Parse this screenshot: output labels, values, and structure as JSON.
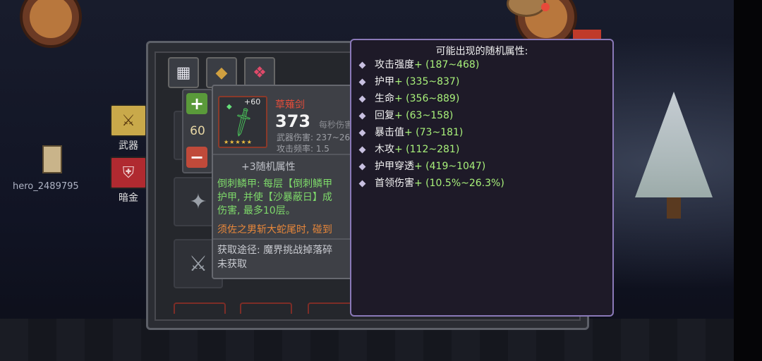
{
  "player": {
    "name": "hero_2489795"
  },
  "sidebar": {
    "weapon_label": "武器",
    "dark_gold_label": "暗金"
  },
  "stepper": {
    "value": "60"
  },
  "weapon": {
    "name": "草薙剑",
    "enhance": "+60",
    "power": "373",
    "per_sec_label": "每秒伤害",
    "damage_label": "武器伤害: 237~26",
    "frequency_label": "攻击频率: 1.5",
    "random_attr_label": "+3随机属性",
    "desc_line1": "倒刺鳞甲: 每层【倒刺鳞甲",
    "desc_line2": "护甲, 并使【沙暴蔽日】成",
    "desc_line3": "伤害, 最多10层。",
    "flavor": "须佐之男斩大蛇尾时, 碰到",
    "source_line1": "获取途径: 魔界挑战掉落碎",
    "source_line2": "未获取",
    "stars": "★★★★★"
  },
  "tooltip": {
    "title": "可能出现的随机属性:",
    "attributes": [
      {
        "name": "攻击强度",
        "range": "+ (187~468)"
      },
      {
        "name": "护甲",
        "range": "+ (335~837)"
      },
      {
        "name": "生命",
        "range": "+ (356~889)"
      },
      {
        "name": "回复",
        "range": "+ (63~158)"
      },
      {
        "name": "暴击值",
        "range": "+ (73~181)"
      },
      {
        "name": "木攻",
        "range": "+ (112~281)"
      },
      {
        "name": "护甲穿透",
        "range": "+ (419~1047)"
      },
      {
        "name": "首领伤害",
        "range": "+ (10.5%~26.3%)"
      }
    ]
  },
  "colors": {
    "tooltip_border": "#8a79b8",
    "range_green": "#a8f07a",
    "weapon_red": "#e24c3a",
    "desc_green": "#7ed96a",
    "flavor_orange": "#e8873a"
  }
}
